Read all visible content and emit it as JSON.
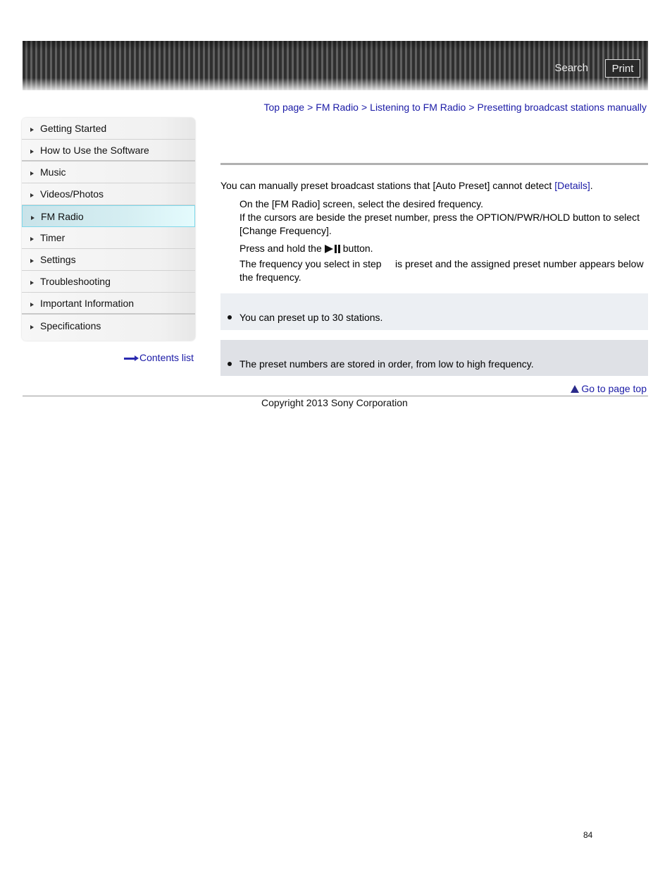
{
  "header": {
    "search_label": "Search",
    "print_label": "Print"
  },
  "breadcrumb": [
    {
      "label": "Top page"
    },
    {
      "label": "FM Radio"
    },
    {
      "label": "Listening to FM Radio"
    },
    {
      "label": "Presetting broadcast stations manually"
    }
  ],
  "breadcrumb_separator": ">",
  "sidebar": {
    "items": [
      {
        "label": "Getting Started",
        "active": false
      },
      {
        "label": "How to Use the Software",
        "active": false
      },
      {
        "label": "Music",
        "active": false
      },
      {
        "label": "Videos/Photos",
        "active": false
      },
      {
        "label": "FM Radio",
        "active": true
      },
      {
        "label": "Timer",
        "active": false
      },
      {
        "label": "Settings",
        "active": false
      },
      {
        "label": "Troubleshooting",
        "active": false
      },
      {
        "label": "Important Information",
        "active": false
      },
      {
        "label": "Specifications",
        "active": false
      }
    ],
    "contents_list_label": "Contents list"
  },
  "main": {
    "intro_text": "You can manually preset broadcast stations that [Auto Preset] cannot detect ",
    "intro_link": "[Details]",
    "intro_end": ".",
    "step1_line1": "On the [FM Radio] screen, select the desired frequency.",
    "step1_line2": "If the cursors are beside the preset number, press the OPTION/PWR/HOLD button to select [Change Frequency].",
    "step2_before": "Press and hold the",
    "step2_icon": "play-pause-icon",
    "step2_after": "button.",
    "step2_result": "The frequency you select in step     is preset and the assigned preset number appears below the frequency.",
    "hint_text": "You can preset up to 30 stations.",
    "note_text": "The preset numbers are stored in order, from low to high frequency."
  },
  "footer": {
    "go_to_top_label": "Go to page top",
    "copyright": "Copyright 2013 Sony Corporation",
    "page_number": "84"
  }
}
